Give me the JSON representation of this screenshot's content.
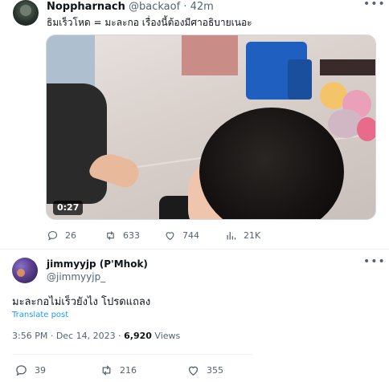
{
  "tweet1": {
    "display_name": "Noppharnach",
    "handle": "@backaof",
    "separator": "·",
    "time_ago": "42m",
    "text": "ธิมเร็วโหด = มะละกอ เรื่องนี้ต้องมีศาอธิบายเนอะ",
    "video_duration": "0:27",
    "replies": "26",
    "retweets": "633",
    "likes": "744",
    "views": "21K"
  },
  "tweet2": {
    "display_name": "jimmyyjp (P'Mhok)",
    "handle": "@jimmyyjp_",
    "text": "มะละกอไม่เร็วยังไง โปรดแถลง",
    "translate_label": "Translate post",
    "time": "3:56 PM",
    "date_sep": "·",
    "date": "Dec 14, 2023",
    "views_sep": "·",
    "views_count": "6,920",
    "views_label": "Views",
    "replies": "39",
    "retweets": "216",
    "likes": "355"
  },
  "colors": {
    "text_primary": "#0f1419",
    "text_muted": "#536471",
    "link": "#1d9bf0"
  },
  "icons": [
    "more-icon",
    "reply-icon",
    "retweet-icon",
    "like-icon",
    "views-icon"
  ]
}
